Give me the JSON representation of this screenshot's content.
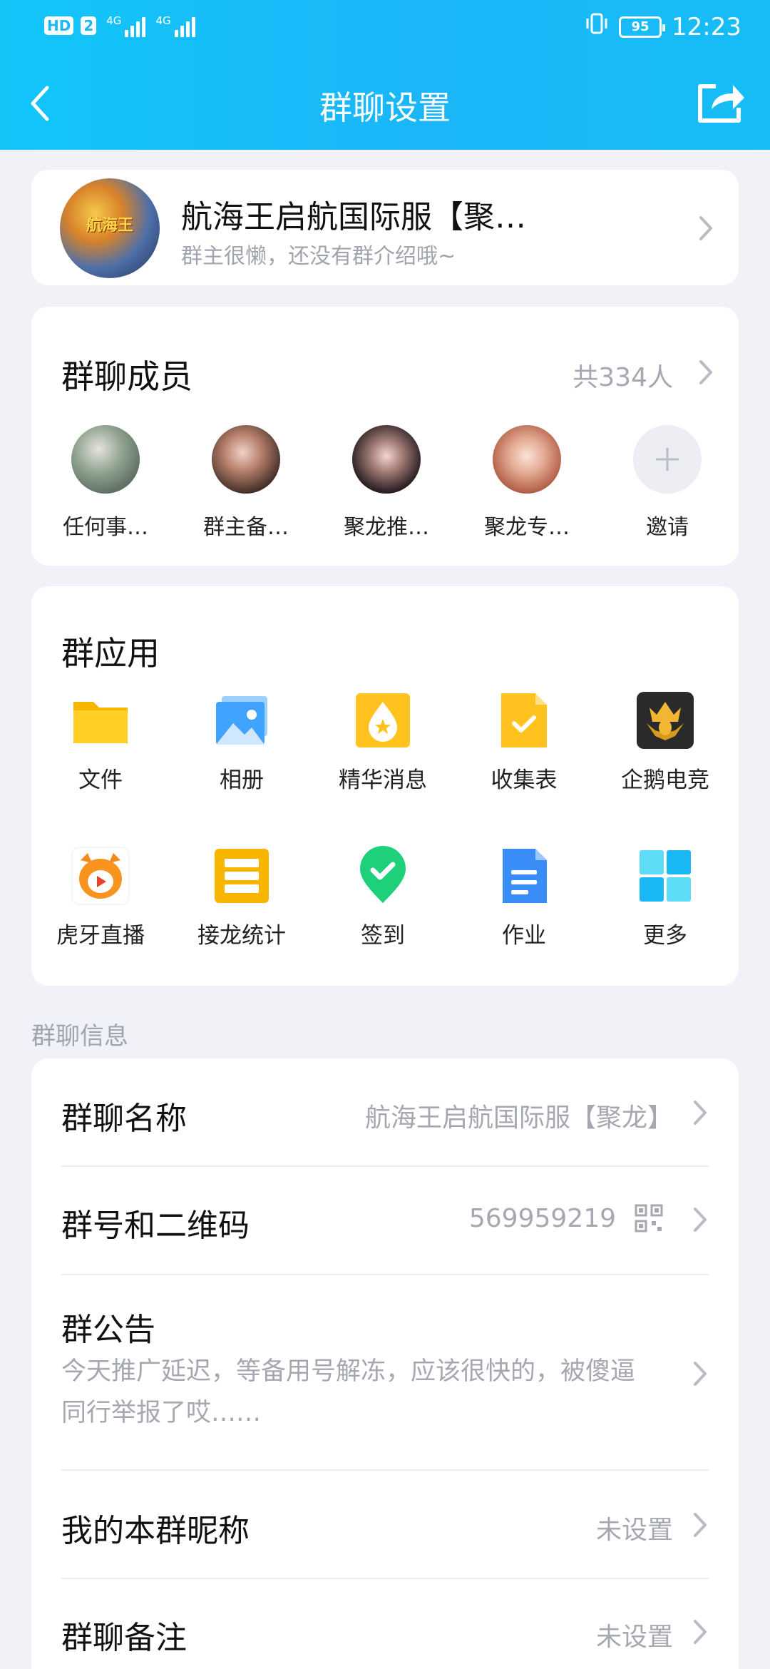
{
  "status_bar": {
    "hd_badge": "HD",
    "sim_badge": "2",
    "network1": "4G",
    "network2": "4G",
    "battery": "95",
    "time": "12:23"
  },
  "navbar": {
    "title": "群聊设置",
    "back_icon": "chevron-left-icon",
    "share_icon": "share-icon"
  },
  "group": {
    "avatar_text": "航海王",
    "name": "航海王启航国际服【聚…",
    "intro": "群主很懒，还没有群介绍哦~"
  },
  "members": {
    "title": "群聊成员",
    "count": "共334人",
    "list": [
      {
        "name": "任何事…",
        "color": "#6b7f6e"
      },
      {
        "name": "群主备…",
        "color": "#5a4438"
      },
      {
        "name": "聚龙推…",
        "color": "#3b2a2c"
      },
      {
        "name": "聚龙专…",
        "color": "#c98a74"
      }
    ],
    "invite_label": "邀请"
  },
  "apps": {
    "title": "群应用",
    "items": [
      {
        "label": "文件",
        "icon": "folder-icon"
      },
      {
        "label": "相册",
        "icon": "photo-album-icon"
      },
      {
        "label": "精华消息",
        "icon": "essence-message-icon"
      },
      {
        "label": "收集表",
        "icon": "collection-form-icon"
      },
      {
        "label": "企鹅电竞",
        "icon": "penguin-esports-icon"
      },
      {
        "label": "虎牙直播",
        "icon": "huya-live-icon"
      },
      {
        "label": "接龙统计",
        "icon": "relay-statistics-icon"
      },
      {
        "label": "签到",
        "icon": "check-in-icon"
      },
      {
        "label": "作业",
        "icon": "homework-icon"
      },
      {
        "label": "更多",
        "icon": "more-apps-icon"
      }
    ]
  },
  "info": {
    "section_label": "群聊信息",
    "rows": {
      "name": {
        "title": "群聊名称",
        "value": "航海王启航国际服【聚龙】"
      },
      "number": {
        "title": "群号和二维码",
        "value": "569959219"
      },
      "notice": {
        "title": "群公告",
        "line1": "今天推广延迟，等备用号解冻，应该很快的，被傻逼",
        "line2": "同行举报了哎……"
      },
      "nickname": {
        "title": "我的本群昵称",
        "value": "未设置"
      },
      "remark": {
        "title": "群聊备注",
        "value": "未设置"
      }
    }
  }
}
